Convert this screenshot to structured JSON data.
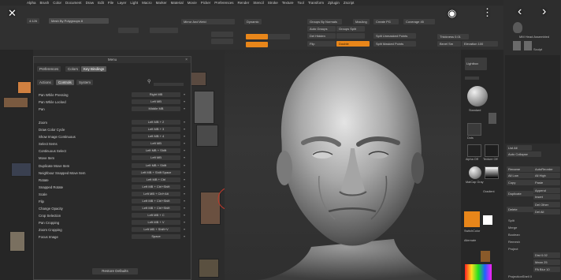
{
  "menubar": [
    "Alpha",
    "Brush",
    "Color",
    "Document",
    "Draw",
    "Edit",
    "File",
    "Layer",
    "Light",
    "Macro",
    "Marker",
    "Material",
    "Movie",
    "Picker",
    "Preferences",
    "Render",
    "Stencil",
    "Stroke",
    "Texture",
    "Tool",
    "Transform",
    "Zplugin",
    "Zscript"
  ],
  "toolbar": {
    "ratio": "4:126",
    "mode_label": "Mesh By Polygroups 8",
    "mirror_weld": "Mirror And Weld",
    "dynamic": "Dynamic",
    "groups_by_normals": "Groups By Normals",
    "maxang": "MaxAng",
    "auto_groups": "Auto Groups",
    "groups_split": "Groups Split",
    "del_hidden": "Del Hidden",
    "flip": "Flip",
    "double": "Double",
    "create_pg": "Create PG",
    "split_unmasked": "Split Unmasked Points",
    "split_masked": "Split Masked Points",
    "thickness": "Thickness 0.01",
    "bevel_sm": "Bevel Sm",
    "elevation": "Elevation 100",
    "coverage": "Coverage 45"
  },
  "dialog": {
    "title": "Menu",
    "tabs": [
      "Preferences",
      "Colors",
      "Key Bindings"
    ],
    "subtabs": [
      "Actions",
      "Controls",
      "System"
    ],
    "rows": [
      {
        "label": "Pan While Pressing",
        "value": "Right MB"
      },
      {
        "label": "Pan While Locked",
        "value": "Left MB"
      },
      {
        "label": "Pan",
        "value": "Middle MB"
      },
      {
        "label": "Zoom",
        "value": "Left MB + 2"
      },
      {
        "label": "Draw Color Cycle",
        "value": "Left MB + 3"
      },
      {
        "label": "Show Image Continuous",
        "value": "Left MB + 4"
      },
      {
        "label": "Select Items",
        "value": "Left MB"
      },
      {
        "label": "Continuous Select",
        "value": "Left MB + Shift"
      },
      {
        "label": "Move Item",
        "value": "Left MB"
      },
      {
        "label": "Duplicate Move Item",
        "value": "Left MB + Shift"
      },
      {
        "label": "Neighbour Snapped Move Item",
        "value": "Left MB + Shift Space"
      },
      {
        "label": "Rotate",
        "value": "Left MB + Ctrl"
      },
      {
        "label": "Snapped Rotate",
        "value": "Left MB + Ctrl+Shift"
      },
      {
        "label": "Scale",
        "value": "Left MB + Ctrl+Alt"
      },
      {
        "label": "Flip",
        "value": "Left MB + Ctrl+Shift"
      },
      {
        "label": "Change Opacity",
        "value": "Left MB + Ctrl+Shift"
      },
      {
        "label": "Crop Selection",
        "value": "Left MB + C"
      },
      {
        "label": "Pan Cropping",
        "value": "Left MB + V"
      },
      {
        "label": "Zoom Cropping",
        "value": "Left MB + Shift+V"
      },
      {
        "label": "Focus Image",
        "value": "Space"
      }
    ],
    "restore_label": "Restore Defaults"
  },
  "dock": {
    "lightbox": "Lightbox",
    "brush_label": "Standard",
    "dots": "Dots",
    "alpha_off": "Alpha Off",
    "texture_off": "Texture Off",
    "matcap": "MatCap Gray",
    "gradient": "Gradient",
    "switch_color": "SwitchColor",
    "alternate": "Alternate"
  },
  "rightpanel": {
    "tool_name": "MM Head Assembled",
    "sculpt_label": "Sculpt",
    "list_all": "List All",
    "auto_collapse": "Auto Collapse",
    "rename": "Rename",
    "auto_reorder": "AutoReorder",
    "all_low": "All Low",
    "all_high": "All High",
    "copy": "Copy",
    "paste": "Paste",
    "duplicate": "Duplicate",
    "append": "Append",
    "insert": "Insert",
    "delete": "Delete",
    "del_other": "Del Other",
    "del_all": "Del All",
    "split": "Split",
    "merge": "Merge",
    "boolean": "Boolean",
    "remesh": "Remesh",
    "project": "Project",
    "dist": "Dist 0.02",
    "mean": "Mean 25",
    "pa_blur": "PA Blur 10",
    "projection_shell": "ProjectionShell 0"
  },
  "overlay": {
    "close": "✕",
    "lens": "◉",
    "more": "⋮",
    "prev": "‹",
    "next": "›"
  },
  "colors": {
    "accent": "#e8861a",
    "bg": "#1a1a1a"
  }
}
